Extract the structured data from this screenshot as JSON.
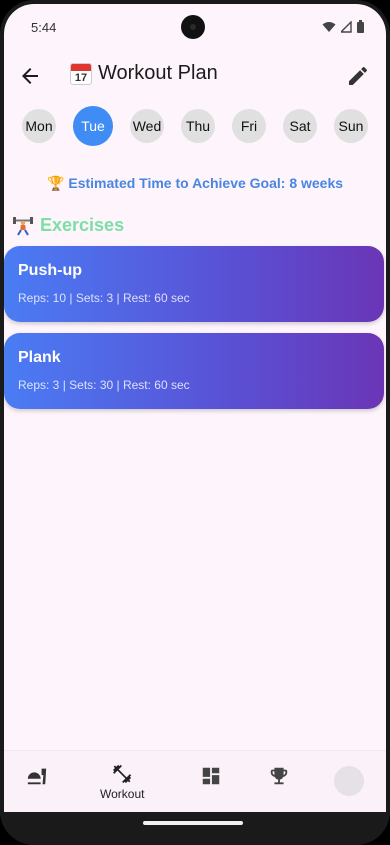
{
  "status_bar": {
    "time": "5:44"
  },
  "app_bar": {
    "calendar_day": "17",
    "title": "Workout Plan"
  },
  "days": [
    {
      "label": "Mon",
      "active": false
    },
    {
      "label": "Tue",
      "active": true
    },
    {
      "label": "Wed",
      "active": false
    },
    {
      "label": "Thu",
      "active": false
    },
    {
      "label": "Fri",
      "active": false
    },
    {
      "label": "Sat",
      "active": false
    },
    {
      "label": "Sun",
      "active": false
    }
  ],
  "goal": {
    "text": "Estimated Time to Achieve Goal: 8 weeks",
    "icon": "trophy-icon"
  },
  "exercises_section": {
    "title": "Exercises",
    "icon": "weightlifter-icon"
  },
  "exercises": [
    {
      "name": "Push-up",
      "meta": "Reps: 10  |  Sets: 3  |  Rest: 60 sec"
    },
    {
      "name": "Plank",
      "meta": "Reps: 3  |  Sets: 30  |  Rest: 60 sec"
    }
  ],
  "bottom_nav": {
    "items": [
      {
        "icon": "food-icon",
        "label": ""
      },
      {
        "icon": "dumbbell-icon",
        "label": "Workout"
      },
      {
        "icon": "dashboard-icon",
        "label": ""
      },
      {
        "icon": "trophy-icon",
        "label": ""
      },
      {
        "icon": "avatar",
        "label": ""
      }
    ]
  },
  "colors": {
    "accent": "#3F8CF4",
    "goal_text": "#4A86E0",
    "section_title": "#7CE0A6",
    "card_gradient_start": "#4A7CF4",
    "card_gradient_end": "#6A36B6",
    "background": "#FDF4FC"
  }
}
